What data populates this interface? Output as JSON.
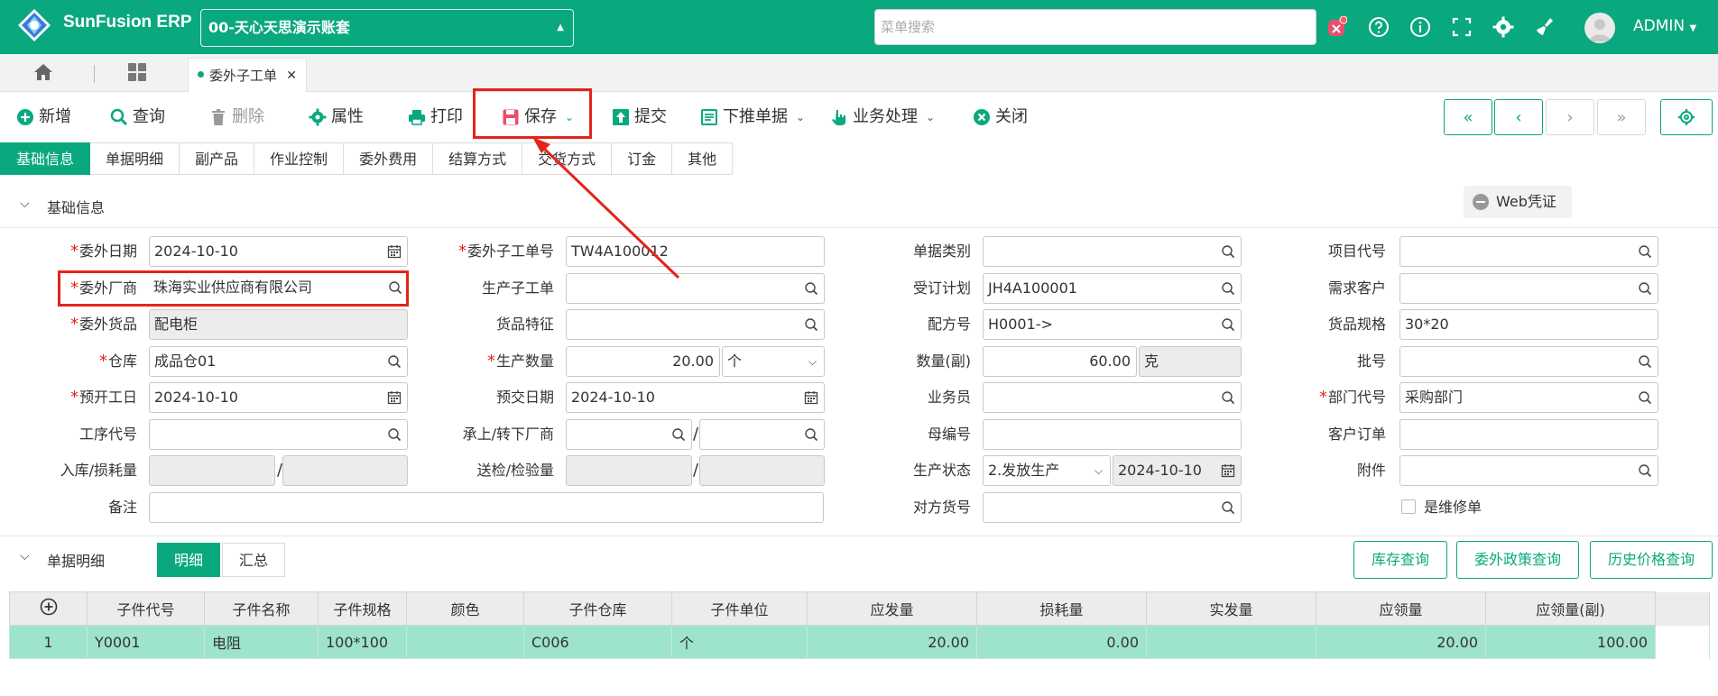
{
  "header": {
    "app_name": "SunFusion ERP",
    "account": "00-天心天思演示账套",
    "search_placeholder": "菜单搜索",
    "user": "ADMIN",
    "brand_color": "#0aa87f"
  },
  "tabs": {
    "doc_tab": "委外子工单"
  },
  "toolbar": {
    "new": "新增",
    "query": "查询",
    "delete": "删除",
    "properties": "属性",
    "print": "打印",
    "save": "保存",
    "submit": "提交",
    "push_down": "下推单据",
    "business": "业务处理",
    "close": "关闭"
  },
  "section_tabs": [
    "基础信息",
    "单据明细",
    "副产品",
    "作业控制",
    "委外费用",
    "结算方式",
    "交货方式",
    "订金",
    "其他"
  ],
  "basic": {
    "title": "基础信息",
    "web_voucher": "Web凭证"
  },
  "form": {
    "outsource_date": {
      "label": "委外日期",
      "value": "2024-10-10"
    },
    "vendor": {
      "label": "委外厂商",
      "value": "珠海实业供应商有限公司"
    },
    "outsource_goods": {
      "label": "委外货品",
      "value": "配电柜"
    },
    "warehouse": {
      "label": "仓库",
      "value": "成品仓01"
    },
    "planned_start": {
      "label": "预开工日",
      "value": "2024-10-10"
    },
    "process_code": {
      "label": "工序代号",
      "value": ""
    },
    "inbound_loss": {
      "label": "入库/损耗量",
      "value": ""
    },
    "remark": {
      "label": "备注",
      "value": ""
    },
    "sub_order_no": {
      "label": "委外子工单号",
      "value": "TW4A100012"
    },
    "prod_sub_order": {
      "label": "生产子工单",
      "value": ""
    },
    "goods_feature": {
      "label": "货品特征",
      "value": ""
    },
    "prod_qty": {
      "label": "生产数量",
      "value": "20.00",
      "unit": "个"
    },
    "due_date": {
      "label": "预交日期",
      "value": "2024-10-10"
    },
    "transfer_vendor": {
      "label": "承上/转下厂商",
      "value": ""
    },
    "inspection_qty": {
      "label": "送检/检验量",
      "value": ""
    },
    "doc_type": {
      "label": "单据类别",
      "value": ""
    },
    "order_plan": {
      "label": "受订计划",
      "value": "JH4A100001"
    },
    "formula_no": {
      "label": "配方号",
      "value": "H0001->"
    },
    "qty_sub": {
      "label": "数量(副)",
      "value": "60.00",
      "unit": "克"
    },
    "salesman": {
      "label": "业务员",
      "value": ""
    },
    "parent_no": {
      "label": "母编号",
      "value": ""
    },
    "prod_status": {
      "label": "生产状态",
      "value": "2.发放生产",
      "date": "2024-10-10"
    },
    "counterpart_goods": {
      "label": "对方货号",
      "value": ""
    },
    "project_code": {
      "label": "项目代号",
      "value": ""
    },
    "demand_customer": {
      "label": "需求客户",
      "value": ""
    },
    "goods_spec": {
      "label": "货品规格",
      "value": "30*20"
    },
    "batch_no": {
      "label": "批号",
      "value": ""
    },
    "dept_code": {
      "label": "部门代号",
      "value": "采购部门"
    },
    "customer_order": {
      "label": "客户订单",
      "value": ""
    },
    "attachment": {
      "label": "附件",
      "value": ""
    },
    "is_repair": {
      "label": "是维修单",
      "checked": false
    }
  },
  "detail": {
    "title": "单据明细",
    "seg_detail": "明细",
    "seg_summary": "汇总",
    "btn_stock": "库存查询",
    "btn_policy": "委外政策查询",
    "btn_price": "历史价格查询",
    "columns": [
      "子件代号",
      "子件名称",
      "子件规格",
      "颜色",
      "子件仓库",
      "子件单位",
      "应发量",
      "损耗量",
      "实发量",
      "应领量",
      "应领量(副)"
    ],
    "rows": [
      {
        "idx": "1",
        "code": "Y0001",
        "name": "电阻",
        "spec": "100*100",
        "color": "",
        "warehouse": "C006",
        "unit": "个",
        "issue_qty": "20.00",
        "loss_qty": "0.00",
        "actual_qty": "",
        "req_qty": "20.00",
        "req_qty_sub": "100.00"
      }
    ]
  }
}
